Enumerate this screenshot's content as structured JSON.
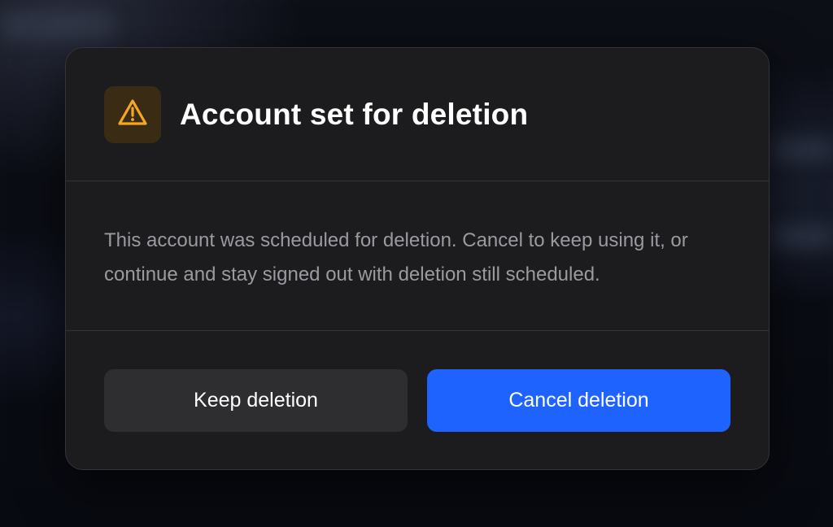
{
  "dialog": {
    "icon": "warning-triangle-icon",
    "title": "Account set for deletion",
    "message": "This account was scheduled for deletion. Cancel to keep using it, or continue and stay signed out with deletion still scheduled.",
    "secondary_button_label": "Keep deletion",
    "primary_button_label": "Cancel deletion"
  },
  "colors": {
    "warning": "#f5a623",
    "warning_badge_bg": "#3a2c14",
    "primary": "#1f63ff",
    "secondary_button_bg": "#2e2e31",
    "dialog_bg": "#1c1c1e"
  }
}
